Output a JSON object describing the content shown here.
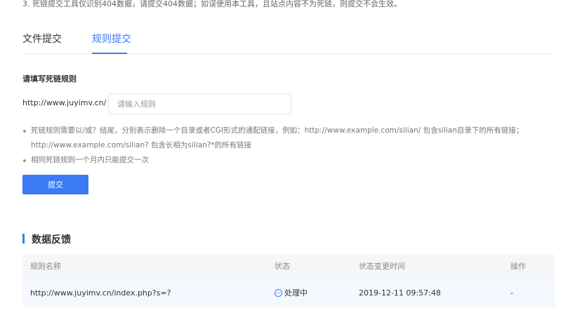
{
  "notice": "3. 死链提交工具仅识别404数据，请提交404数据；如误使用本工具，且站点内容不为死链，则提交不会生效。",
  "tabs": [
    {
      "label": "文件提交",
      "active": false
    },
    {
      "label": "规则提交",
      "active": true
    }
  ],
  "form": {
    "section_label": "请填写死链规则",
    "prefix": "http://www.juyimv.cn/",
    "input_value": "",
    "input_placeholder": "请输入规则",
    "tips": [
      {
        "line1": "死链规则需要以/或？结尾，分别表示删除一个目录或者CGI形式的通配链接，例如：http://www.example.com/silian/ 包含silian目录下的所有链接；",
        "line2": "http://www.example.com/silian? 包含长相为silian?*的所有链接"
      },
      {
        "line1": "相同死链规则一个月内只能提交一次"
      }
    ],
    "submit_label": "提交"
  },
  "feedback": {
    "title": "数据反馈",
    "columns": [
      "规则名称",
      "状态",
      "状态变更时间",
      "操作"
    ],
    "rows": [
      {
        "rule": "http://www.juyimv.cn/index.php?s=?",
        "status": "处理中",
        "status_icon": "more-circle-icon",
        "time": "2019-12-11 09:57:48",
        "action": "-"
      }
    ]
  },
  "colors": {
    "accent": "#3a7bf5",
    "table_header_bg": "#f5f6f8",
    "row_bg": "#f5f8ff"
  }
}
